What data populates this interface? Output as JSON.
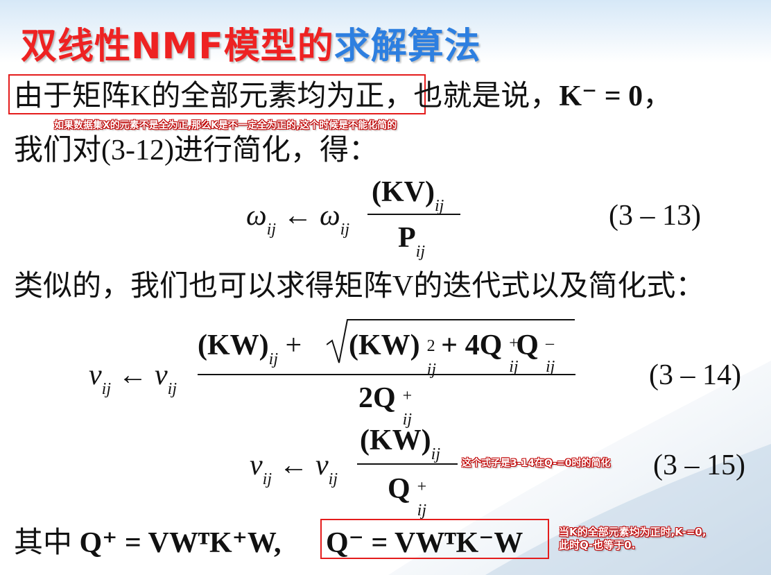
{
  "title": {
    "red": "双线性NMF模型的",
    "blue": "求解算法"
  },
  "line1": {
    "boxed": "由于矩阵K的全部元素均为正",
    "rest": "，也就是说，",
    "math": "K⁻ = 0",
    "tail": "，"
  },
  "note1": "如果数据集X的元素不是全为正,那么K是不一定全为正的,这个时候是不能化简的",
  "line2": "我们对(3-12)进行简化，得：",
  "eq13": {
    "lhs": "ω",
    "arrow": "←",
    "rhs": "ω",
    "num": "(KV)",
    "den": "P",
    "sub": "ij",
    "label": "(3 – 13)"
  },
  "line3": "类似的，我们也可以求得矩阵V的迭代式以及简化式：",
  "eq14": {
    "lhs": "v",
    "rhs": "v",
    "arrow": "←",
    "num_a": "(KW)",
    "plus": "+",
    "num_b": "(KW)",
    "sq": "2",
    "num_c": "+ 4Q",
    "num_d": "Q",
    "den": "2Q",
    "sub": "ij",
    "label": "(3 – 14)"
  },
  "eq15": {
    "lhs": "v",
    "rhs": "v",
    "arrow": "←",
    "num": "(KW)",
    "den": "Q",
    "sub": "ij",
    "label": "(3 – 15)"
  },
  "note2": "这个式子是3-14在Q-=0时的简化",
  "line4": {
    "prefix": "其中",
    "qplus": "Q⁺ = VWᵀK⁺W,",
    "qminus": "Q⁻ = VWᵀK⁻W"
  },
  "note3": [
    "当K的全部元素均为正时,K-=0,",
    "此时Q-也等于0."
  ],
  "colors": {
    "title_red": "#ee2222",
    "title_blue": "#2d7fe0",
    "box_red": "#e41c1c"
  }
}
